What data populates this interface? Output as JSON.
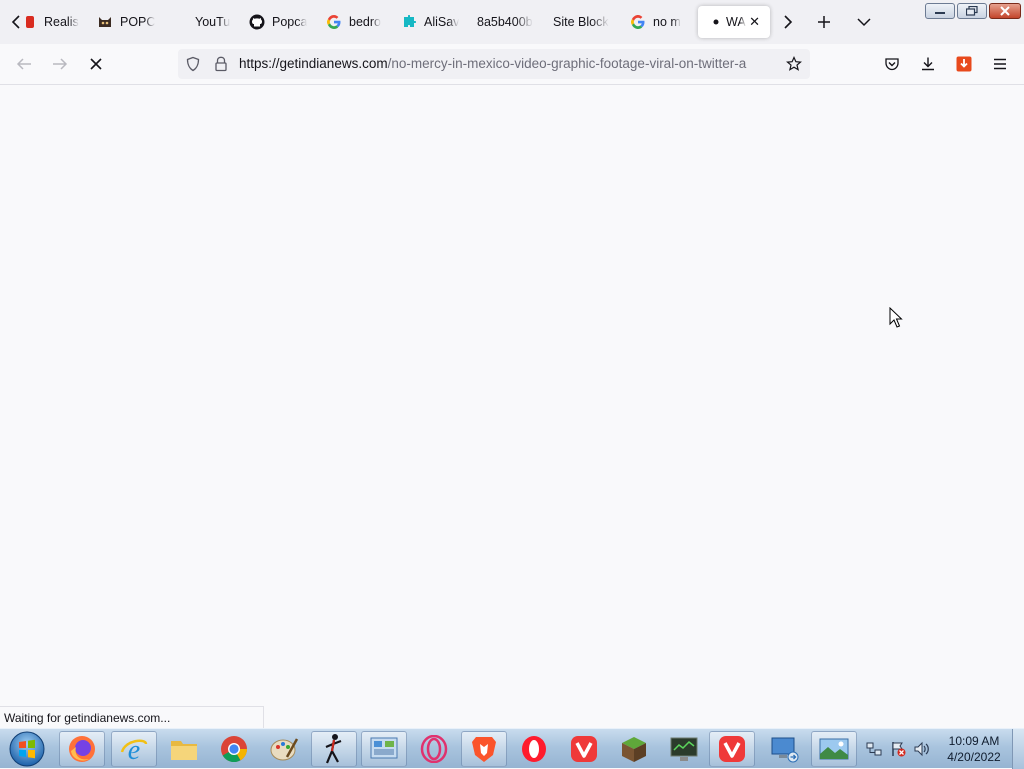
{
  "browser": {
    "tabs": [
      {
        "label": "Realis",
        "icon": "red-brand-icon"
      },
      {
        "label": "POPC",
        "icon": "cat-icon"
      },
      {
        "label": "YouTu",
        "icon": "youtube-icon"
      },
      {
        "label": "Popca",
        "icon": "github-icon"
      },
      {
        "label": "bedro",
        "icon": "google-icon"
      },
      {
        "label": "AliSav",
        "icon": "puzzle-icon"
      },
      {
        "label": "8a5b400b",
        "icon": "none"
      },
      {
        "label": "Site Block",
        "icon": "none"
      },
      {
        "label": "no m",
        "icon": "google-icon"
      },
      {
        "label": "WA",
        "icon": "loading-dot-icon",
        "active": true
      }
    ],
    "url": {
      "host": "https://getindianews.com",
      "path": "/no-mercy-in-mexico-video-graphic-footage-viral-on-twitter-a"
    },
    "status_text": "Waiting for getindianews.com..."
  },
  "taskbar": {
    "apps": [
      "firefox-icon",
      "internet-explorer-icon",
      "file-explorer-icon",
      "chrome-icon",
      "paint-icon",
      "stick-figure-app-icon",
      "control-panel-icon",
      "opera-gx-icon",
      "brave-icon",
      "opera-icon",
      "vivaldi-icon",
      "minecraft-icon",
      "terminal-monitor-icon",
      "vivaldi-icon",
      "remote-desktop-icon",
      "photo-viewer-icon"
    ],
    "clock_time": "10:09 AM",
    "clock_date": "4/20/2022"
  },
  "colors": {
    "accent": "#0060df",
    "brave": "#fb542b",
    "opera": "#ff1b2d",
    "vivaldi": "#ef3939"
  }
}
